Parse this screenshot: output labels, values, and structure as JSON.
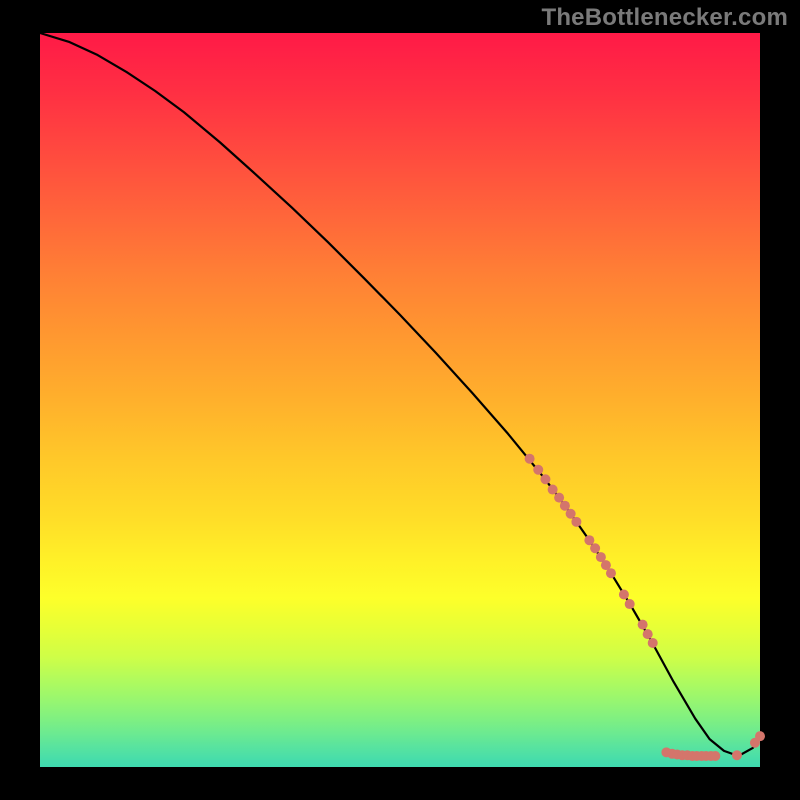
{
  "watermark": "TheBottlenecker.com",
  "chart_data": {
    "type": "line",
    "title": "",
    "xlabel": "",
    "ylabel": "",
    "xlim": [
      0,
      100
    ],
    "ylim": [
      0,
      100
    ],
    "series": [
      {
        "name": "curve",
        "x": [
          0,
          4,
          8,
          12,
          16,
          20,
          25,
          30,
          35,
          40,
          45,
          50,
          55,
          60,
          65,
          70,
          73,
          76,
          79,
          82,
          85,
          88,
          91,
          93,
          95,
          97,
          99,
          100
        ],
        "y": [
          100,
          98.8,
          97.0,
          94.7,
          92.1,
          89.2,
          85.1,
          80.7,
          76.2,
          71.5,
          66.6,
          61.6,
          56.4,
          51.0,
          45.4,
          39.4,
          35.5,
          31.3,
          26.9,
          22.1,
          17.0,
          11.6,
          6.6,
          3.8,
          2.2,
          1.5,
          2.6,
          4.2
        ]
      }
    ],
    "markers": [
      {
        "x": 68.0,
        "y": 42.0
      },
      {
        "x": 69.2,
        "y": 40.5
      },
      {
        "x": 70.2,
        "y": 39.2
      },
      {
        "x": 71.2,
        "y": 37.8
      },
      {
        "x": 72.1,
        "y": 36.7
      },
      {
        "x": 72.9,
        "y": 35.6
      },
      {
        "x": 73.7,
        "y": 34.5
      },
      {
        "x": 74.5,
        "y": 33.4
      },
      {
        "x": 76.3,
        "y": 30.9
      },
      {
        "x": 77.1,
        "y": 29.8
      },
      {
        "x": 77.9,
        "y": 28.6
      },
      {
        "x": 78.6,
        "y": 27.5
      },
      {
        "x": 79.3,
        "y": 26.4
      },
      {
        "x": 81.1,
        "y": 23.5
      },
      {
        "x": 81.9,
        "y": 22.2
      },
      {
        "x": 83.7,
        "y": 19.4
      },
      {
        "x": 84.4,
        "y": 18.1
      },
      {
        "x": 85.1,
        "y": 16.9
      },
      {
        "x": 87.0,
        "y": 2.0
      },
      {
        "x": 87.8,
        "y": 1.8
      },
      {
        "x": 88.5,
        "y": 1.7
      },
      {
        "x": 89.2,
        "y": 1.6
      },
      {
        "x": 89.9,
        "y": 1.6
      },
      {
        "x": 90.6,
        "y": 1.5
      },
      {
        "x": 91.2,
        "y": 1.5
      },
      {
        "x": 91.9,
        "y": 1.5
      },
      {
        "x": 92.5,
        "y": 1.5
      },
      {
        "x": 93.2,
        "y": 1.5
      },
      {
        "x": 93.8,
        "y": 1.5
      },
      {
        "x": 96.8,
        "y": 1.6
      },
      {
        "x": 99.3,
        "y": 3.3
      },
      {
        "x": 100.0,
        "y": 4.2
      }
    ],
    "gradient_stops": [
      {
        "pos": 0.0,
        "color": "#ff1a47"
      },
      {
        "pos": 0.5,
        "color": "#ffb02c"
      },
      {
        "pos": 0.77,
        "color": "#fdff2a"
      },
      {
        "pos": 1.0,
        "color": "#3fdaaf"
      }
    ],
    "marker_color": "#d4756b",
    "curve_color": "#000000"
  }
}
